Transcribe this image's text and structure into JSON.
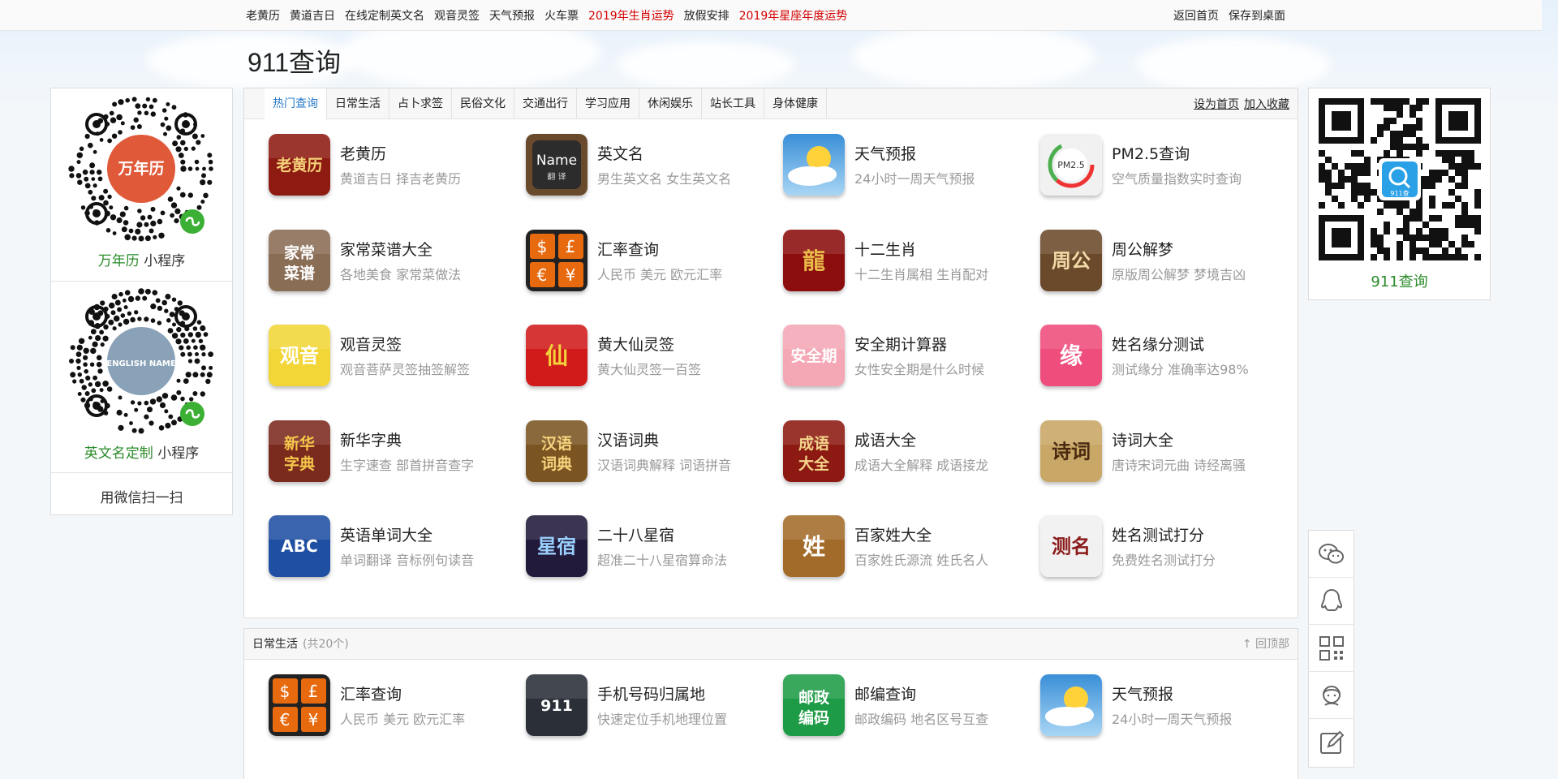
{
  "topnav": {
    "links": [
      {
        "label": "老黄历",
        "red": false
      },
      {
        "label": "黄道吉日",
        "red": false
      },
      {
        "label": "在线定制英文名",
        "red": false
      },
      {
        "label": "观音灵签",
        "red": false
      },
      {
        "label": "天气预报",
        "red": false
      },
      {
        "label": "火车票",
        "red": false
      },
      {
        "label": "2019年生肖运势",
        "red": true
      },
      {
        "label": "放假安排",
        "red": false
      },
      {
        "label": "2019年星座年度运势",
        "red": true
      }
    ],
    "right": [
      "返回首页",
      "保存到桌面"
    ]
  },
  "site_title": "911查询",
  "left_panel": {
    "qr1_badge": "万年历",
    "qr1_caption_green": "万年历",
    "qr1_caption_rest": " 小程序",
    "qr2_badge": "ENGLISH NAME",
    "qr2_caption_green": "英文名定制",
    "qr2_caption_rest": " 小程序",
    "scan_text": "用微信扫一扫"
  },
  "tabs": [
    "热门查询",
    "日常生活",
    "占卜求签",
    "民俗文化",
    "交通出行",
    "学习应用",
    "休闲娱乐",
    "站长工具",
    "身体健康"
  ],
  "tab_links": [
    "设为首页",
    "加入收藏"
  ],
  "hot_items": [
    {
      "title": "老黄历",
      "sub": "黄道吉日 择吉老黄历",
      "icon": "almanac-icon",
      "icon_text": "老黄历",
      "bg": "#8e1b12",
      "fg": "#f5d27a"
    },
    {
      "title": "英文名",
      "sub": "男生英文名 女生英文名",
      "icon": "english-name-icon",
      "icon_text": "Name",
      "bg": "#5a3a22",
      "fg": "#ffffff"
    },
    {
      "title": "天气预报",
      "sub": "24小时一周天气预报",
      "icon": "weather-icon",
      "icon_text": "",
      "bg": "#4aa3e0",
      "fg": "#ffffff"
    },
    {
      "title": "PM2.5查询",
      "sub": "空气质量指数实时查询",
      "icon": "pm25-icon",
      "icon_text": "PM2.5",
      "bg": "#eeeeee",
      "fg": "#333333"
    },
    {
      "title": "家常菜谱大全",
      "sub": "各地美食 家常菜做法",
      "icon": "recipe-icon",
      "icon_text": "家常菜谱",
      "bg": "#8a6d55",
      "fg": "#ffffff"
    },
    {
      "title": "汇率查询",
      "sub": "人民币 美元 欧元汇率",
      "icon": "exchange-rate-icon",
      "icon_text": "$£€¥",
      "bg": "#e86a0f",
      "fg": "#ffffff"
    },
    {
      "title": "十二生肖",
      "sub": "十二生肖属相 生肖配对",
      "icon": "zodiac-icon",
      "icon_text": "龍",
      "bg": "#8b0d0d",
      "fg": "#e8b949"
    },
    {
      "title": "周公解梦",
      "sub": "原版周公解梦 梦境吉凶",
      "icon": "dream-icon",
      "icon_text": "周公",
      "bg": "#6b4a2b",
      "fg": "#f1d9a8"
    },
    {
      "title": "观音灵签",
      "sub": "观音菩萨灵签抽签解签",
      "icon": "guanyin-icon",
      "icon_text": "观音",
      "bg": "#f2d638",
      "fg": "#ffffff"
    },
    {
      "title": "黄大仙灵签",
      "sub": "黄大仙灵签一百签",
      "icon": "wong-tai-sin-icon",
      "icon_text": "仙",
      "bg": "#d11b1b",
      "fg": "#f3d23a"
    },
    {
      "title": "安全期计算器",
      "sub": "女性安全期是什么时候",
      "icon": "safe-period-icon",
      "icon_text": "安全期",
      "bg": "#f4a7b5",
      "fg": "#ffffff"
    },
    {
      "title": "姓名缘分测试",
      "sub": "测试缘分 准确率达98%",
      "icon": "name-match-icon",
      "icon_text": "缘",
      "bg": "#ef4d7c",
      "fg": "#ffffff"
    },
    {
      "title": "新华字典",
      "sub": "生字速查 部首拼音查字",
      "icon": "xinhua-dictionary-icon",
      "icon_text": "新华字典",
      "bg": "#7b2a1e",
      "fg": "#f6c84a"
    },
    {
      "title": "汉语词典",
      "sub": "汉语词典解释 词语拼音",
      "icon": "chinese-dictionary-icon",
      "icon_text": "汉语词典",
      "bg": "#7a5522",
      "fg": "#f6d47d"
    },
    {
      "title": "成语大全",
      "sub": "成语大全解释 成语接龙",
      "icon": "idiom-icon",
      "icon_text": "成语大全",
      "bg": "#8c1a12",
      "fg": "#f3d48a"
    },
    {
      "title": "诗词大全",
      "sub": "唐诗宋词元曲 诗经离骚",
      "icon": "poetry-icon",
      "icon_text": "诗词",
      "bg": "#c9a766",
      "fg": "#4a2a10"
    },
    {
      "title": "英语单词大全",
      "sub": "单词翻译 音标例句读音",
      "icon": "english-words-icon",
      "icon_text": "ABC",
      "bg": "#1f4fa3",
      "fg": "#ffffff"
    },
    {
      "title": "二十八星宿",
      "sub": "超准二十八星宿算命法",
      "icon": "constellation-icon",
      "icon_text": "星宿",
      "bg": "#221a3a",
      "fg": "#9ad0ff"
    },
    {
      "title": "百家姓大全",
      "sub": "百家姓氏源流 姓氏名人",
      "icon": "surname-icon",
      "icon_text": "姓",
      "bg": "#a36b2a",
      "fg": "#ffffff"
    },
    {
      "title": "姓名测试打分",
      "sub": "免费姓名测试打分",
      "icon": "name-score-icon",
      "icon_text": "测名",
      "bg": "#f1f1f1",
      "fg": "#8b1a1a"
    }
  ],
  "section2": {
    "title": "日常生活",
    "count": "(共20个)",
    "to_top": "↑ 回顶部",
    "items": [
      {
        "title": "汇率查询",
        "sub": "人民币 美元 欧元汇率",
        "icon": "exchange-rate-icon",
        "icon_text": "$£€¥",
        "bg": "#e86a0f",
        "fg": "#ffffff"
      },
      {
        "title": "手机号码归属地",
        "sub": "快速定位手机地理位置",
        "icon": "phone-location-icon",
        "icon_text": "911",
        "bg": "#2a2f38",
        "fg": "#ffffff"
      },
      {
        "title": "邮编查询",
        "sub": "邮政编码 地名区号互查",
        "icon": "postcode-icon",
        "icon_text": "邮政编码",
        "bg": "#1e9b46",
        "fg": "#ffffff"
      },
      {
        "title": "天气预报",
        "sub": "24小时一周天气预报",
        "icon": "weather-icon",
        "icon_text": "",
        "bg": "#4aa3e0",
        "fg": "#ffffff"
      }
    ]
  },
  "right_qr": {
    "caption": "911查询",
    "badge": "911查"
  },
  "float_bar": [
    "wechat-icon",
    "qq-icon",
    "qrcode-icon",
    "customer-service-icon",
    "feedback-edit-icon"
  ]
}
